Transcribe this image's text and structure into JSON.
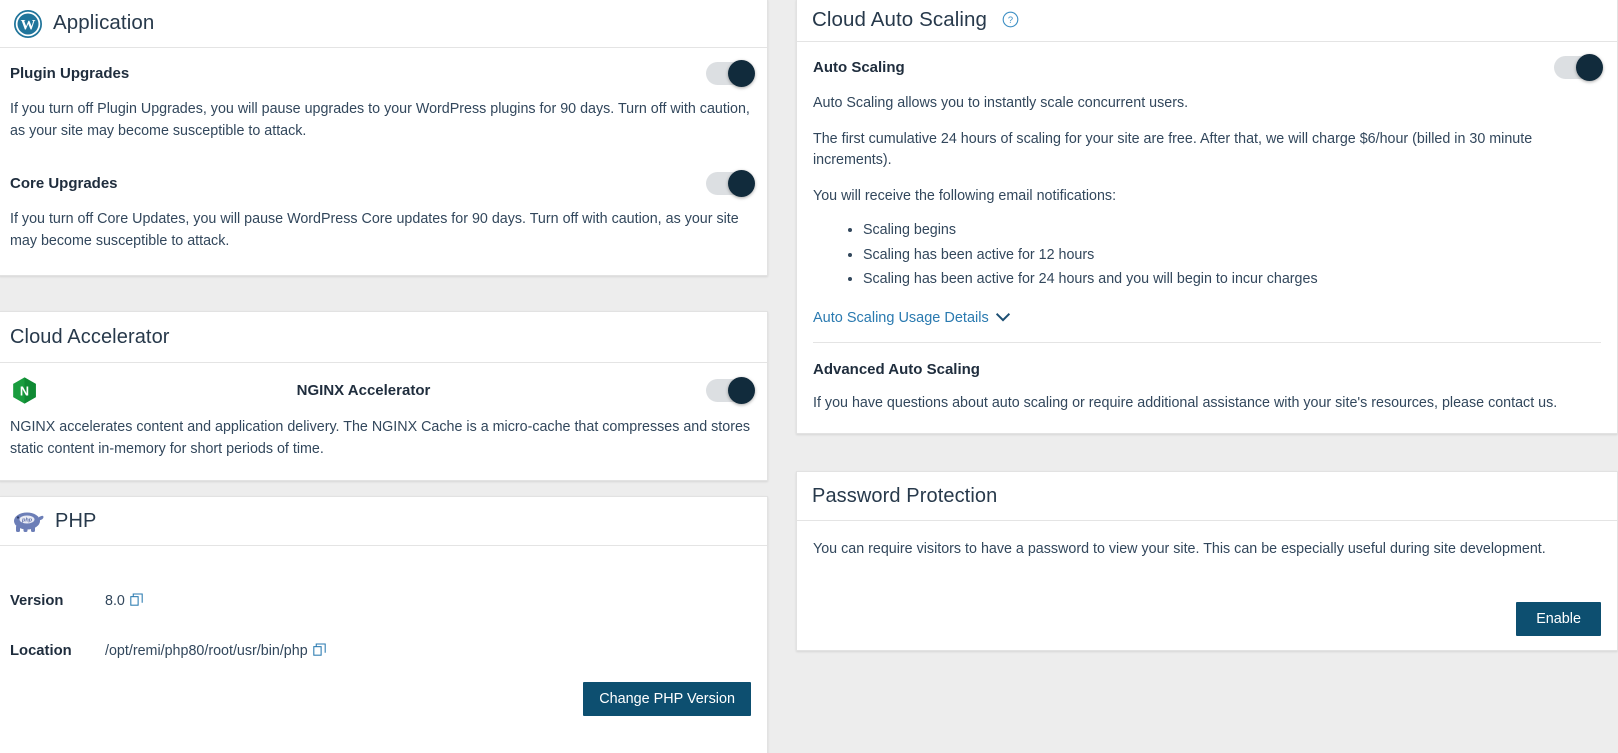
{
  "left_column": {
    "application_card": {
      "title": "Application",
      "icon": "wordpress-icon",
      "blocks": [
        {
          "label": "Plugin Upgrades",
          "description": "If you turn off Plugin Upgrades, you will pause upgrades to your WordPress plugins for 90 days. Turn off with caution, as your site may become susceptible to attack.",
          "toggle_state": "on"
        },
        {
          "label": "Core Upgrades",
          "description": "If you turn off Core Updates, you will pause WordPress Core updates for 90 days. Turn off with caution, as your site may become susceptible to attack.",
          "toggle_state": "on"
        }
      ]
    },
    "cloud_accelerator_card": {
      "title": "Cloud Accelerator",
      "row_icon": "nginx-icon",
      "row_label": "NGINX Accelerator",
      "toggle_state": "on",
      "description": "NGINX accelerates content and application delivery. The NGINX Cache is a micro-cache that compresses and stores static content in-memory for short periods of time."
    },
    "php_card": {
      "title": "PHP",
      "icon": "php-elephant-icon",
      "rows": [
        {
          "key": "Version",
          "value": "8.0",
          "copy_icon": "copy-icon"
        },
        {
          "key": "Location",
          "value": "/opt/remi/php80/root/usr/bin/php",
          "copy_icon": "copy-icon"
        }
      ],
      "button_label": "Change PHP Version"
    }
  },
  "right_column": {
    "auto_scaling_card": {
      "title": "Cloud Auto Scaling",
      "help_icon": "help-circle-icon",
      "section_label": "Auto Scaling",
      "toggle_state": "on",
      "paragraph_1": "Auto Scaling allows you to instantly scale concurrent users.",
      "paragraph_2": "The first cumulative 24 hours of scaling for your site are free. After that, we will charge $6/hour (billed in 30 minute increments).",
      "paragraph_3": "You will receive the following email notifications:",
      "bullets": [
        "Scaling begins",
        "Scaling has been active for 12 hours",
        "Scaling has been active for 24 hours and you will begin to incur charges"
      ],
      "usage_details_link": "Auto Scaling Usage Details",
      "chevron_icon": "chevron-down-icon",
      "advanced_heading": "Advanced Auto Scaling",
      "advanced_text": "If you have questions about auto scaling or require additional assistance with your site's resources, please contact us."
    },
    "password_protection_card": {
      "title": "Password Protection",
      "description": "You can require visitors to have a password to view your site. This can be especially useful during site development.",
      "button_label": "Enable"
    }
  },
  "colors": {
    "page_background": "#ededed",
    "card_background": "#ffffff",
    "heading_text": "#27394b",
    "body_text": "#32475c",
    "primary_button": "#0d4f70",
    "link": "#2a7ab0",
    "toggle_knob_on": "#112b3c",
    "toggle_track": "#dcdfe2",
    "nginx_green": "#199c3e",
    "wordpress_blue": "#21759b",
    "php_purple": "#6c7eb7"
  }
}
